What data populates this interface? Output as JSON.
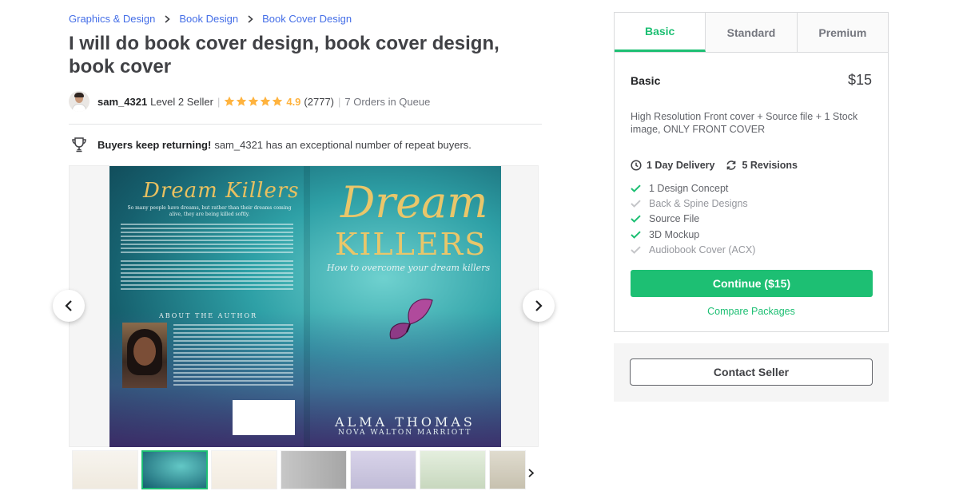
{
  "breadcrumb": [
    "Graphics & Design",
    "Book Design",
    "Book Cover Design"
  ],
  "gig": {
    "title": "I will do book cover design, book cover design, book cover"
  },
  "seller": {
    "name": "sam_4321",
    "level": "Level 2 Seller",
    "rating": "4.9",
    "rating_count": "(2777)",
    "orders_in_queue": "7 Orders in Queue",
    "star_count": 5
  },
  "repeat_buyers": {
    "bold": "Buyers keep returning!",
    "text": "sam_4321 has an exceptional number of repeat buyers."
  },
  "gallery": {
    "cover_back_title": "Dream Killers",
    "cover_back_subtitle": "So many people have dreams, but rather than their dreams coming alive, they are being killed softly.",
    "cover_about_label": "ABOUT THE AUTHOR",
    "cover_front_title_1": "Dream",
    "cover_front_title_2": "KILLERS",
    "cover_tagline": "How to overcome your dream killers",
    "cover_author": "ALMA THOMAS",
    "cover_coauthor": "NOVA WALTON MARRIOTT",
    "thumbnail_count": 7,
    "active_thumbnail": 1
  },
  "packages": {
    "tabs": [
      "Basic",
      "Standard",
      "Premium"
    ],
    "active_tab": "Basic",
    "name": "Basic",
    "price": "$15",
    "description": "High Resolution Front cover + Source file + 1 Stock image, ONLY FRONT COVER",
    "delivery": "1 Day Delivery",
    "revisions": "5 Revisions",
    "features": [
      {
        "label": "1 Design Concept",
        "included": true
      },
      {
        "label": "Back & Spine Designs",
        "included": false
      },
      {
        "label": "Source File",
        "included": true
      },
      {
        "label": "3D Mockup",
        "included": true
      },
      {
        "label": "Audiobook Cover (ACX)",
        "included": false
      }
    ],
    "continue_label": "Continue ($15)",
    "compare_label": "Compare Packages"
  },
  "contact": {
    "label": "Contact Seller"
  },
  "colors": {
    "accent": "#1dbf73",
    "link": "#446ee7",
    "star": "#ffb33e"
  }
}
